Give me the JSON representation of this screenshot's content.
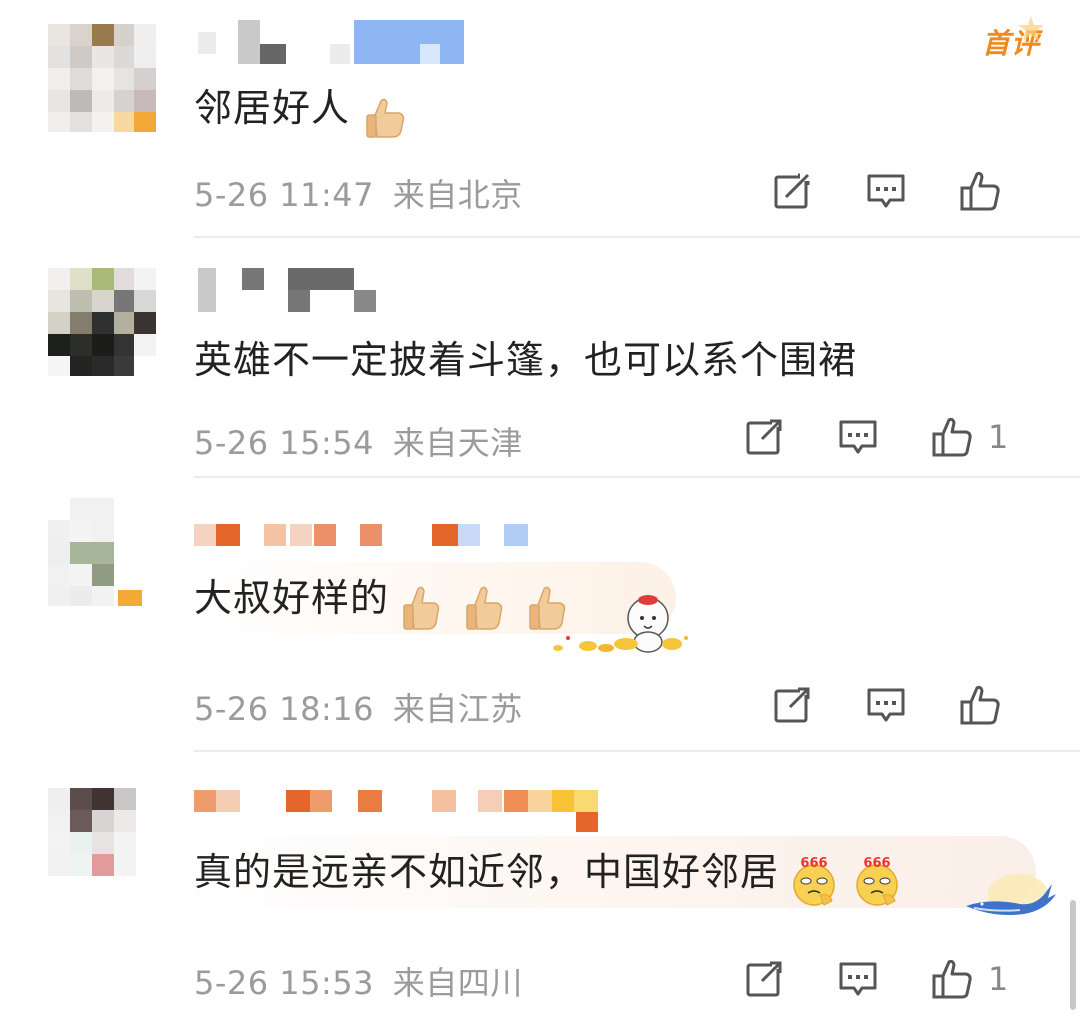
{
  "comments": [
    {
      "text": "邻居好人",
      "time": "5-26 11:47",
      "location": "来自北京",
      "badge": "首评",
      "likes": "",
      "emoji_icons": [
        "thumbs-up-icon"
      ]
    },
    {
      "text": "英雄不一定披着斗篷，也可以系个围裙",
      "time": "5-26 15:54",
      "location": "来自天津",
      "badge": "",
      "likes": "1",
      "emoji_icons": []
    },
    {
      "text": "大叔好样的",
      "time": "5-26 18:16",
      "location": "来自江苏",
      "badge": "",
      "likes": "",
      "emoji_icons": [
        "thumbs-up-icon",
        "thumbs-up-icon",
        "thumbs-up-icon"
      ]
    },
    {
      "text": "真的是远亲不如近邻，中国好邻居",
      "time": "5-26 15:53",
      "location": "来自四川",
      "badge": "",
      "likes": "1",
      "emoji_icons": [
        "666-face-icon",
        "666-face-icon"
      ]
    }
  ],
  "icons": {
    "repost": "repost-icon",
    "reply": "comment-icon",
    "like": "like-icon"
  },
  "colors": {
    "badge": "#f08a1c",
    "meta_text": "#9b9b9b",
    "divider": "#ececec"
  }
}
